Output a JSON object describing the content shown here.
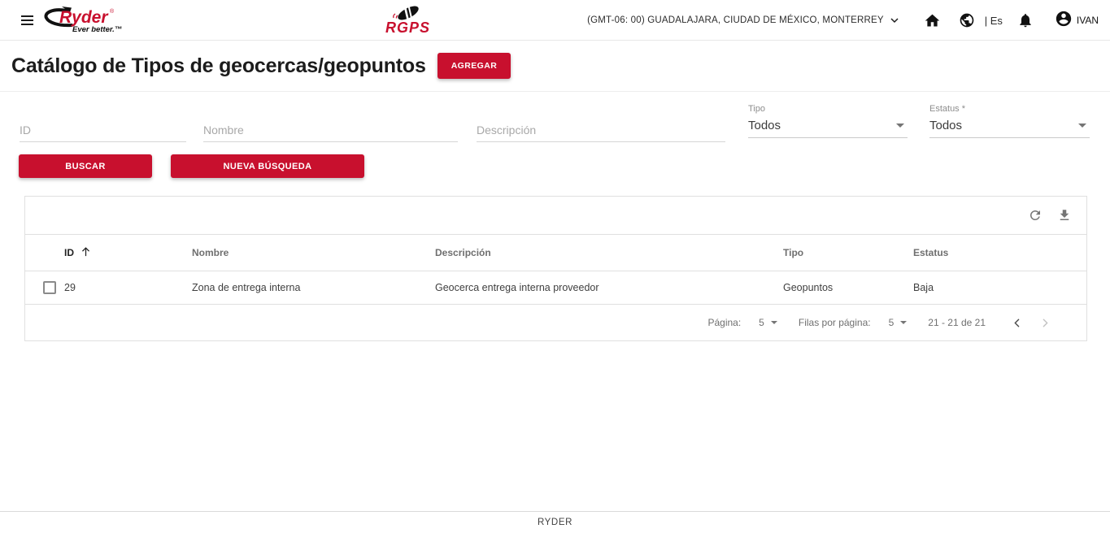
{
  "header": {
    "brand_name": "Ryder",
    "brand_reg": "®",
    "brand_tagline": "Ever better.™",
    "app_logo": "RGPS",
    "timezone": "(GMT-06: 00) GUADALAJARA, CIUDAD DE MÉXICO, MONTERREY",
    "lang": "| Es",
    "user": "IVAN"
  },
  "page": {
    "title": "Catálogo de Tipos de geocercas/geopuntos",
    "add_button": "AGREGAR"
  },
  "filters": {
    "id_placeholder": "ID",
    "nombre_placeholder": "Nombre",
    "descripcion_placeholder": "Descripción",
    "tipo": {
      "label": "Tipo",
      "value": "Todos"
    },
    "estatus": {
      "label": "Estatus *",
      "value": "Todos"
    },
    "search_button": "BUSCAR",
    "new_search_button": "NUEVA BÚSQUEDA"
  },
  "table": {
    "columns": [
      "ID",
      "Nombre",
      "Descripción",
      "Tipo",
      "Estatus"
    ],
    "rows": [
      {
        "id": "29",
        "nombre": "Zona de entrega interna",
        "descripcion": "Geocerca entrega interna proveedor",
        "tipo": "Geopuntos",
        "estatus": "Baja"
      }
    ],
    "pagination": {
      "page_label": "Página:",
      "page_value": "5",
      "rows_label": "Filas por página:",
      "rows_value": "5",
      "range": "21 - 21 de 21"
    }
  },
  "footer": {
    "text": "RYDER"
  },
  "colors": {
    "accent": "#c8102e",
    "icon_gray": "#757575",
    "border_gray": "#e0e0e0"
  },
  "icons": {
    "menu": "☰",
    "satellite": "black satellite glyph",
    "chevron-down": "⌄",
    "home": "⌂",
    "globe": "🌐",
    "bell": "🔔",
    "user-avatar": "👤",
    "refresh": "↻",
    "download": "⭳",
    "sort-ascending": "↑",
    "page-prev": "‹",
    "page-next": "›",
    "dropdown-caret": "▾"
  }
}
